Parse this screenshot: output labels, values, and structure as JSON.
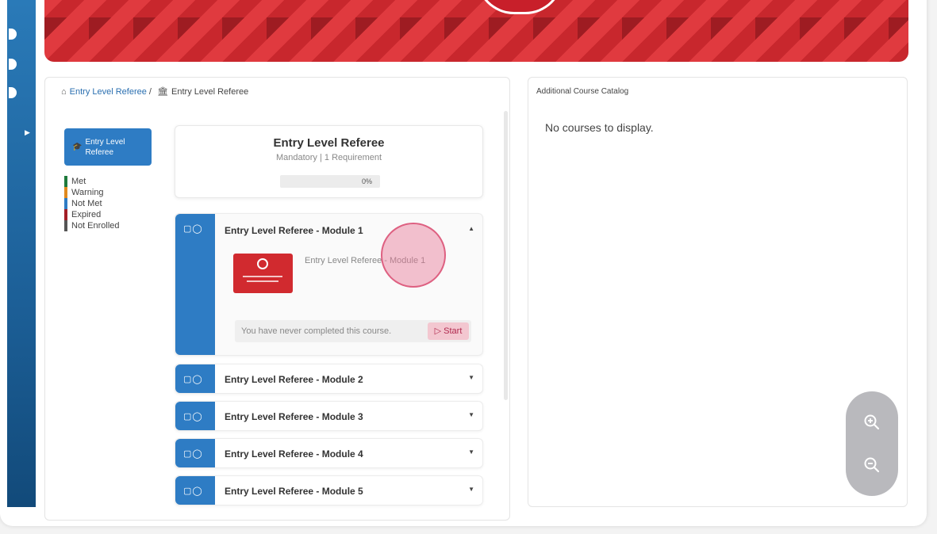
{
  "breadcrumb": {
    "first": "Entry Level Referee",
    "separator": " /",
    "second": "Entry Level Referee"
  },
  "program_button": {
    "label_line1": "Entry Level",
    "label_line2": "Referee"
  },
  "legend": [
    {
      "label": "Met",
      "color": "#1e7a3c"
    },
    {
      "label": "Warning",
      "color": "#e08a1e"
    },
    {
      "label": "Not Met",
      "color": "#2e7cc4"
    },
    {
      "label": "Expired",
      "color": "#a31e27"
    },
    {
      "label": "Not Enrolled",
      "color": "#555555"
    }
  ],
  "requirement": {
    "title": "Entry Level Referee",
    "subtitle": "Mandatory | 1 Requirement",
    "progress_text": "0%",
    "progress_value": 0
  },
  "modules": [
    {
      "title": "Entry Level Referee - Module 1",
      "caret": "▲"
    },
    {
      "title": "Entry Level Referee - Module 2",
      "caret": "▼"
    },
    {
      "title": "Entry Level Referee - Module 3",
      "caret": "▼"
    },
    {
      "title": "Entry Level Referee - Module 4",
      "caret": "▼"
    },
    {
      "title": "Entry Level Referee - Module 5",
      "caret": "▼"
    }
  ],
  "expanded_module": {
    "course_name": "Entry Level Referee - Module 1",
    "completion_text": "You have never completed this course.",
    "start_label": "Start",
    "start_icon": "▷"
  },
  "catalog": {
    "title": "Additional Course Catalog",
    "empty_text": "No courses to display."
  },
  "icons": {
    "home": "home-icon",
    "bank": "institution-icon",
    "cap": "graduation-cap-icon",
    "module_type": "▢◯",
    "zoom_in": "zoom-in-icon",
    "zoom_out": "zoom-out-icon"
  },
  "colors": {
    "accent_blue": "#2e7cc4",
    "banner_red": "#e03a3f",
    "start_pink": "#f3c7d0"
  }
}
